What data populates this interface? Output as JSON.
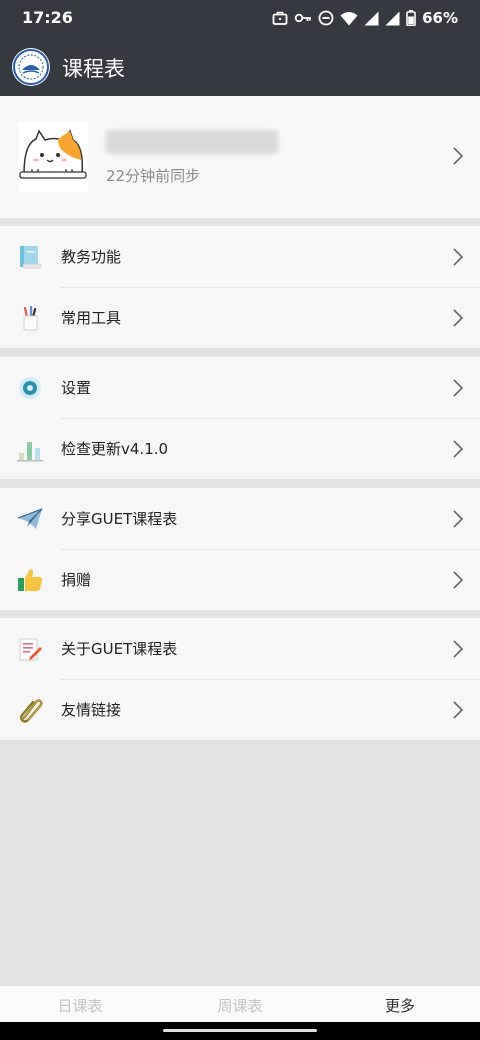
{
  "status_bar": {
    "time": "17:26",
    "battery_percent": "66%",
    "icons": [
      "briefcase-icon",
      "key-icon",
      "dnd-icon",
      "wifi-icon",
      "signal-icon",
      "signal-icon",
      "battery-icon"
    ]
  },
  "app_bar": {
    "title": "课程表",
    "background": "#363a40"
  },
  "profile": {
    "sync_text": "22分钟前同步"
  },
  "menu_groups": [
    {
      "items": [
        {
          "label": "教务功能",
          "icon": "book-icon"
        },
        {
          "label": "常用工具",
          "icon": "pen-holder-icon"
        }
      ]
    },
    {
      "items": [
        {
          "label": "设置",
          "icon": "settings-icon"
        },
        {
          "label": "检查更新v4.1.0",
          "icon": "bar-chart-icon"
        }
      ]
    },
    {
      "items": [
        {
          "label": "分享GUET课程表",
          "icon": "paper-plane-icon"
        },
        {
          "label": "捐赠",
          "icon": "thumbs-up-icon"
        }
      ]
    },
    {
      "items": [
        {
          "label": "关于GUET课程表",
          "icon": "notepad-icon"
        },
        {
          "label": "友情链接",
          "icon": "paperclip-icon"
        }
      ]
    }
  ],
  "bottom_nav": {
    "tabs": [
      {
        "label": "日课表",
        "active": false
      },
      {
        "label": "周课表",
        "active": false
      },
      {
        "label": "更多",
        "active": true
      }
    ]
  }
}
